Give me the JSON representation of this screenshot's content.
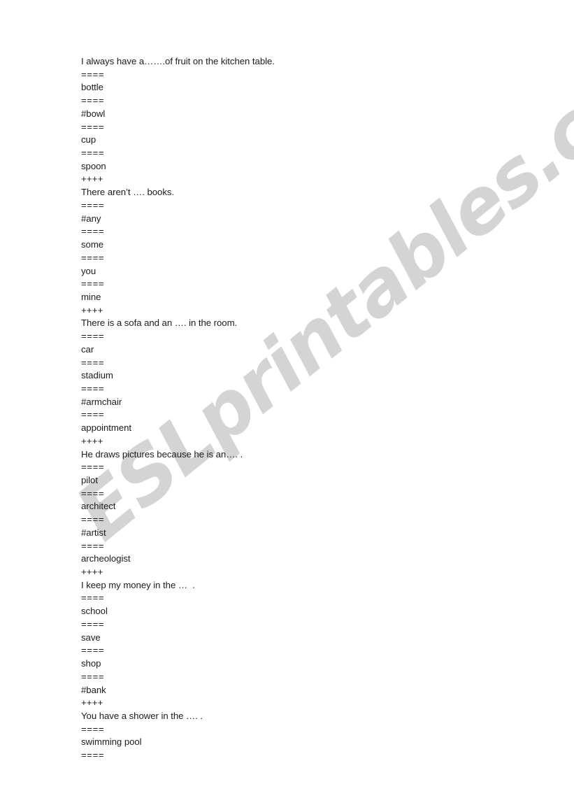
{
  "document": {
    "type": "esl-quiz-worksheet",
    "background_color": "#ffffff",
    "text_color": "#1b1b1b"
  },
  "watermark": {
    "text": "ESLprintables.com",
    "color": "#d4d4d4",
    "rotation_deg": -39
  },
  "separators": {
    "option": "====",
    "question": "++++"
  },
  "lines": [
    {
      "kind": "question",
      "text": "I always have a…….of fruit on the kitchen table."
    },
    {
      "kind": "sep-eq",
      "text": "===="
    },
    {
      "kind": "option",
      "text": "bottle"
    },
    {
      "kind": "sep-eq",
      "text": "===="
    },
    {
      "kind": "correct",
      "text": "#bowl"
    },
    {
      "kind": "sep-eq",
      "text": "===="
    },
    {
      "kind": "option",
      "text": "cup"
    },
    {
      "kind": "sep-eq",
      "text": "===="
    },
    {
      "kind": "option",
      "text": "spoon"
    },
    {
      "kind": "sep-pl",
      "text": "++++"
    },
    {
      "kind": "question",
      "text": "There aren’t …. books."
    },
    {
      "kind": "sep-eq",
      "text": "===="
    },
    {
      "kind": "correct",
      "text": "#any"
    },
    {
      "kind": "sep-eq",
      "text": "===="
    },
    {
      "kind": "option",
      "text": "some"
    },
    {
      "kind": "sep-eq",
      "text": "===="
    },
    {
      "kind": "option",
      "text": "you"
    },
    {
      "kind": "sep-eq",
      "text": "===="
    },
    {
      "kind": "option",
      "text": "mine"
    },
    {
      "kind": "sep-pl",
      "text": "++++"
    },
    {
      "kind": "question",
      "text": "There is a sofa and an …. in the room."
    },
    {
      "kind": "sep-eq",
      "text": "===="
    },
    {
      "kind": "option",
      "text": "car"
    },
    {
      "kind": "sep-eq",
      "text": "===="
    },
    {
      "kind": "option",
      "text": "stadium"
    },
    {
      "kind": "sep-eq",
      "text": "===="
    },
    {
      "kind": "correct",
      "text": "#armchair"
    },
    {
      "kind": "sep-eq",
      "text": "===="
    },
    {
      "kind": "option",
      "text": "appointment"
    },
    {
      "kind": "sep-pl",
      "text": "++++"
    },
    {
      "kind": "question",
      "text": "He draws pictures because he is an…. ."
    },
    {
      "kind": "sep-eq",
      "text": "===="
    },
    {
      "kind": "option",
      "text": "pilot"
    },
    {
      "kind": "sep-eq",
      "text": "===="
    },
    {
      "kind": "option",
      "text": "architect"
    },
    {
      "kind": "sep-eq",
      "text": "===="
    },
    {
      "kind": "correct",
      "text": "#artist"
    },
    {
      "kind": "sep-eq",
      "text": "===="
    },
    {
      "kind": "option",
      "text": "archeologist"
    },
    {
      "kind": "sep-pl",
      "text": "++++"
    },
    {
      "kind": "question",
      "text": "I keep my money in the …  ."
    },
    {
      "kind": "sep-eq",
      "text": "===="
    },
    {
      "kind": "option",
      "text": "school"
    },
    {
      "kind": "sep-eq",
      "text": "===="
    },
    {
      "kind": "option",
      "text": "save"
    },
    {
      "kind": "sep-eq",
      "text": "===="
    },
    {
      "kind": "option",
      "text": "shop"
    },
    {
      "kind": "sep-eq",
      "text": "===="
    },
    {
      "kind": "correct",
      "text": "#bank"
    },
    {
      "kind": "sep-pl",
      "text": "++++"
    },
    {
      "kind": "question",
      "text": "You have a shower in the …. ."
    },
    {
      "kind": "sep-eq",
      "text": "===="
    },
    {
      "kind": "option",
      "text": "swimming pool"
    },
    {
      "kind": "sep-eq",
      "text": "===="
    }
  ]
}
